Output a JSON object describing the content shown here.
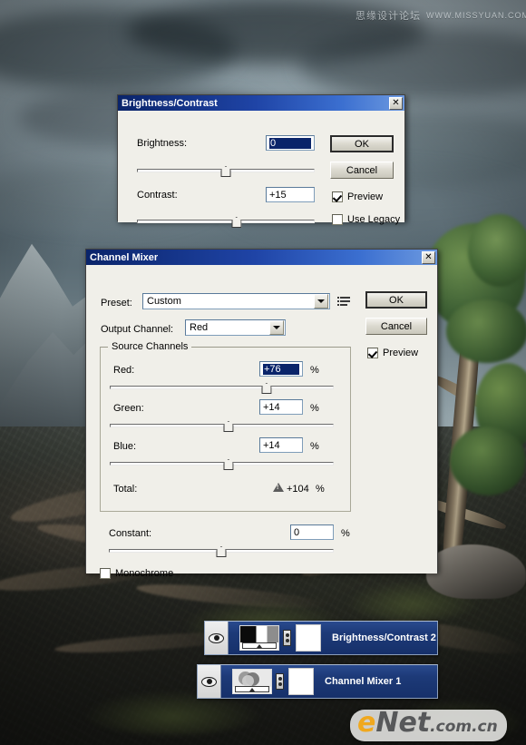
{
  "watermark": {
    "site_cn": "思缘设计论坛",
    "site_url": "WWW.MISSYUAN.COM",
    "logo_e": "e",
    "logo_net": "Net",
    "logo_domain": ".com.cn"
  },
  "brightness_contrast_dialog": {
    "title": "Brightness/Contrast",
    "close_label": "✕",
    "brightness_label": "Brightness:",
    "brightness_value": "0",
    "contrast_label": "Contrast:",
    "contrast_value": "+15",
    "ok_label": "OK",
    "cancel_label": "Cancel",
    "preview_label": "Preview",
    "use_legacy_label": "Use Legacy"
  },
  "channel_mixer_dialog": {
    "title": "Channel Mixer",
    "close_label": "✕",
    "preset_label": "Preset:",
    "preset_value": "Custom",
    "output_channel_label": "Output Channel:",
    "output_channel_value": "Red",
    "source_channels_label": "Source Channels",
    "red_label": "Red:",
    "red_value": "+76",
    "red_unit": "%",
    "green_label": "Green:",
    "green_value": "+14",
    "green_unit": "%",
    "blue_label": "Blue:",
    "blue_value": "+14",
    "blue_unit": "%",
    "total_label": "Total:",
    "total_value": "+104",
    "total_unit": "%",
    "constant_label": "Constant:",
    "constant_value": "0",
    "constant_unit": "%",
    "monochrome_label": "Monochrome",
    "ok_label": "OK",
    "cancel_label": "Cancel",
    "preview_label": "Preview"
  },
  "layers_panel": {
    "rows": [
      {
        "name": "Brightness/Contrast 2"
      },
      {
        "name": "Channel Mixer 1"
      }
    ]
  },
  "colors": {
    "title_bar_start": "#0a246a",
    "title_bar_end": "#6d9ae0",
    "dialog_face": "#f0efe9",
    "selection_blue": "#0a246a",
    "layer_row_blue": "#1d3a78",
    "logo_orange": "#f0a81e"
  }
}
